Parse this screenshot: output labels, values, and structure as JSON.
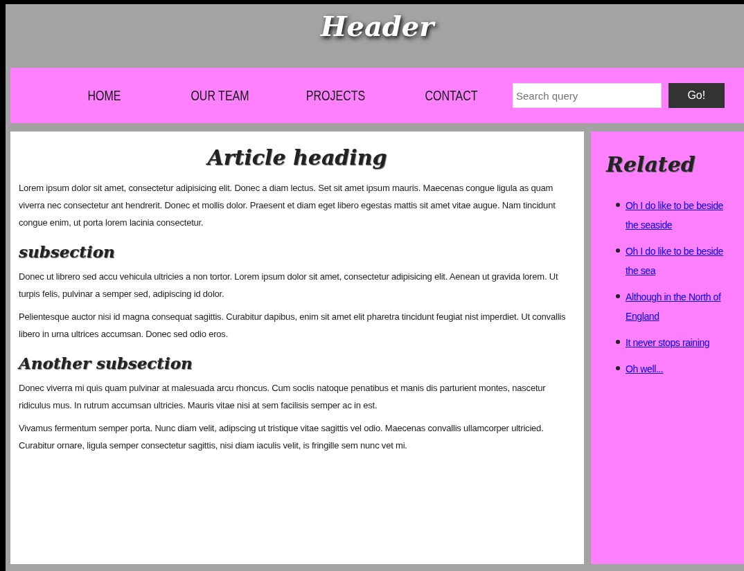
{
  "header": {
    "title": "Header"
  },
  "nav": {
    "items": [
      {
        "label": "HOME"
      },
      {
        "label": "OUR TEAM"
      },
      {
        "label": "PROJECTS"
      },
      {
        "label": "CONTACT"
      }
    ],
    "search": {
      "placeholder": "Search query"
    },
    "button": "Go!"
  },
  "article": {
    "heading": "Article heading",
    "blocks": [
      {
        "kind": "paragraph",
        "text": "Lorem ipsum dolor sit amet, consectetur adipisicing elit. Donec a diam lectus. Set sit amet ipsum mauris. Maecenas congue ligula as quam viverra nec consectetur ant hendrerit. Donec et mollis dolor. Praesent et diam eget libero egestas mattis sit amet vitae augue. Nam tincidunt congue enim, ut porta lorem lacinia consectetur."
      },
      {
        "kind": "subheading",
        "text": "subsection"
      },
      {
        "kind": "paragraph",
        "text": "Donec ut librero sed accu vehicula ultricies a non tortor. Lorem ipsum dolor sit amet, consectetur adipisicing elit. Aenean ut gravida lorem. Ut turpis felis, pulvinar a semper sed, adipiscing id dolor."
      },
      {
        "kind": "paragraph",
        "text": "Pelientesque auctor nisi id magna consequat sagittis. Curabitur dapibus, enim sit amet elit pharetra tincidunt feugiat nist imperdiet. Ut convallis libero in urna ultrices accumsan. Donec sed odio eros."
      },
      {
        "kind": "subheading",
        "text": "Another subsection"
      },
      {
        "kind": "paragraph",
        "text": "Donec viverra mi quis quam pulvinar at malesuada arcu rhoncus. Cum soclis natoque penatibus et manis dis parturient montes, nascetur ridiculus mus. In rutrum accumsan ultricies. Mauris vitae nisi at sem facilisis semper ac in est."
      },
      {
        "kind": "paragraph",
        "text": "Vivamus fermentum semper porta. Nunc diam velit, adipscing ut tristique vitae sagittis vel odio. Maecenas convallis ullamcorper ultricied. Curabitur ornare, ligula semper consectetur sagittis, nisi diam iaculis velit, is fringille sem nunc vet mi."
      }
    ]
  },
  "sidebar": {
    "heading": "Related",
    "links": [
      "Oh I do like to be beside the seaside",
      "Oh I do like to be beside the sea",
      "Although in the North of England",
      "It never stops raining",
      "Oh well..."
    ]
  }
}
